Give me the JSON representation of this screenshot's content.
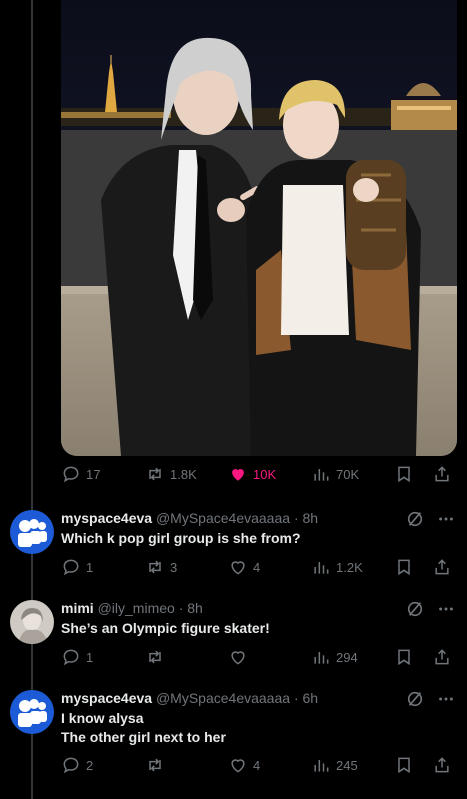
{
  "post": {
    "photo_alt": "Two people posing at night with the Eiffel Tower in the background",
    "actions": {
      "replies": "17",
      "reposts": "1.8K",
      "likes": "10K",
      "views": "70K"
    }
  },
  "replies": [
    {
      "name": "myspace4eva",
      "handle": "@MySpace4evaaaaa",
      "time": "· 8h",
      "text": [
        "Which k pop girl group is she from?"
      ],
      "replies": "1",
      "reposts": "3",
      "likes": "4",
      "views": "1.2K"
    },
    {
      "name": "mimi",
      "handle": "@ily_mimeo",
      "time": "· 8h",
      "text": [
        "She’s an Olympic figure skater!"
      ],
      "replies": "1",
      "reposts": "",
      "likes": "",
      "views": "294"
    },
    {
      "name": "myspace4eva",
      "handle": "@MySpace4evaaaaa",
      "time": "· 6h",
      "text": [
        "I know alysa",
        "The other girl next to her"
      ],
      "replies": "2",
      "reposts": "",
      "likes": "4",
      "views": "245"
    }
  ],
  "colors": {
    "background": "#000000",
    "text": "#e7e9ea",
    "muted": "#71767b",
    "like": "#f91880",
    "myspace_blue": "#1d5bd6"
  }
}
